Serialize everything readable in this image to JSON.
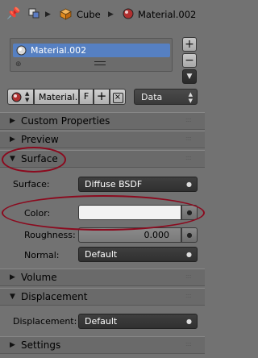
{
  "header": {
    "object_name": "Cube",
    "material_name": "Material.002"
  },
  "slots": {
    "items": [
      {
        "label": "Material.002",
        "selected": true
      }
    ]
  },
  "datablock": {
    "name": "Material.",
    "fake_user": "F",
    "link": "Data"
  },
  "panels": {
    "custom_properties": "Custom Properties",
    "preview": "Preview",
    "surface": "Surface",
    "volume": "Volume",
    "displacement": "Displacement",
    "settings": "Settings"
  },
  "surface": {
    "surface_label": "Surface:",
    "surface_value": "Diffuse BSDF",
    "color_label": "Color:",
    "color_value": "#f2f2f2",
    "roughness_label": "Roughness:",
    "roughness_value": "0.000",
    "normal_label": "Normal:",
    "normal_value": "Default"
  },
  "displacement": {
    "label": "Displacement:",
    "value": "Default"
  },
  "annotations": {
    "ring_color": "#8b0a1e"
  }
}
